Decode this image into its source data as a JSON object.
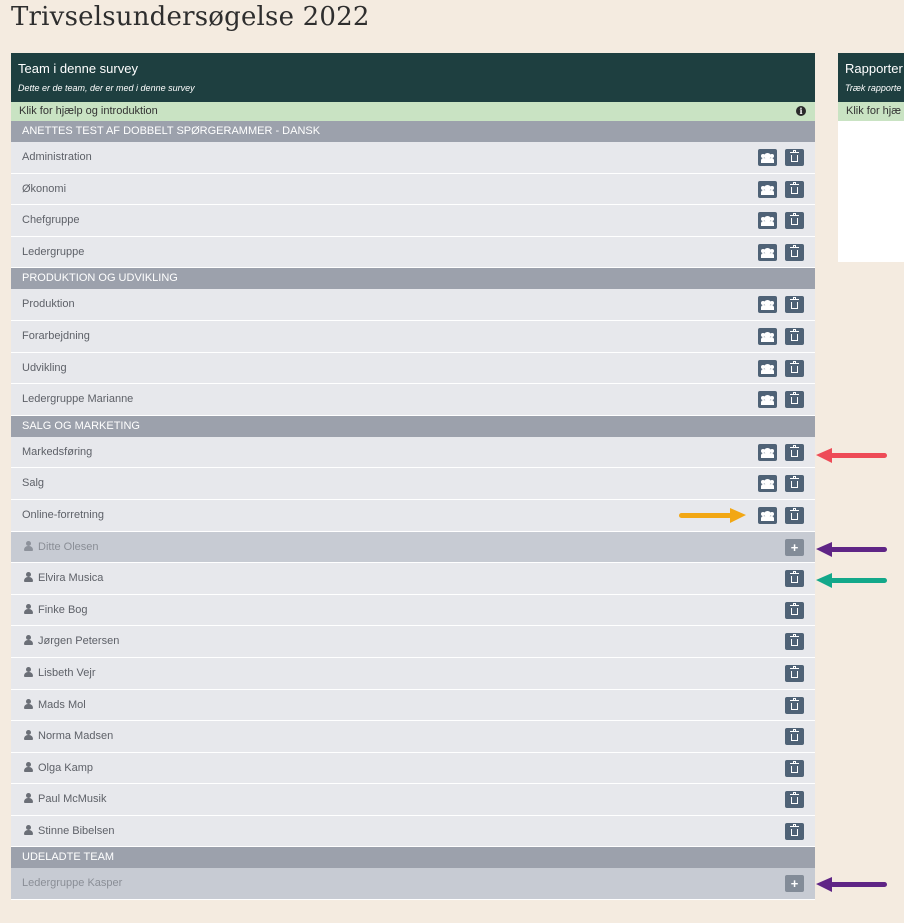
{
  "page_title": "Trivselsundersøgelse 2022",
  "team_panel": {
    "title": "Team i denne survey",
    "subtitle": "Dette er de team, der er med i denne survey",
    "help": "Klik for hjælp og introduktion"
  },
  "reports_panel": {
    "title": "Rapporter",
    "subtitle": "Træk rapporte",
    "help": "Klik for hjæ"
  },
  "groups": [
    {
      "name": "ANETTES TEST AF DOBBELT SPØRGERAMMER - DANSK",
      "teams": [
        "Administration",
        "Økonomi",
        "Chefgruppe",
        "Ledergruppe"
      ]
    },
    {
      "name": "PRODUKTION OG UDVIKLING",
      "teams": [
        "Produktion",
        "Forarbejdning",
        "Udvikling",
        "Ledergruppe Marianne"
      ]
    },
    {
      "name": "SALG OG MARKETING",
      "teams": [
        "Markedsføring",
        "Salg",
        "Online-forretning"
      ],
      "members": [
        {
          "name": "Ditte Olesen",
          "excluded": true
        },
        {
          "name": "Elvira Musica",
          "excluded": false
        },
        {
          "name": "Finke Bog",
          "excluded": false
        },
        {
          "name": "Jørgen Petersen",
          "excluded": false
        },
        {
          "name": "Lisbeth Vejr",
          "excluded": false
        },
        {
          "name": "Mads Mol",
          "excluded": false
        },
        {
          "name": "Norma Madsen",
          "excluded": false
        },
        {
          "name": "Olga Kamp",
          "excluded": false
        },
        {
          "name": "Paul McMusik",
          "excluded": false
        },
        {
          "name": "Stinne Bibelsen",
          "excluded": false
        }
      ]
    }
  ],
  "excluded_group": {
    "name": "UDELADTE TEAM",
    "teams": [
      "Ledergruppe Kasper"
    ]
  },
  "icons": {
    "team_button": "users-icon",
    "delete_button": "trash-icon",
    "add_button": "plus-icon",
    "member": "user-icon",
    "help": "info-icon"
  },
  "colors": {
    "header_bg": "#1e3f40",
    "help_bg": "#c9e3c3",
    "group_bg": "#9ca1ac",
    "button_bg": "#4f6276",
    "arrow_red": "#ee4b57",
    "arrow_orange": "#f2a714",
    "arrow_purple": "#5f2586",
    "arrow_teal": "#13a88a"
  }
}
